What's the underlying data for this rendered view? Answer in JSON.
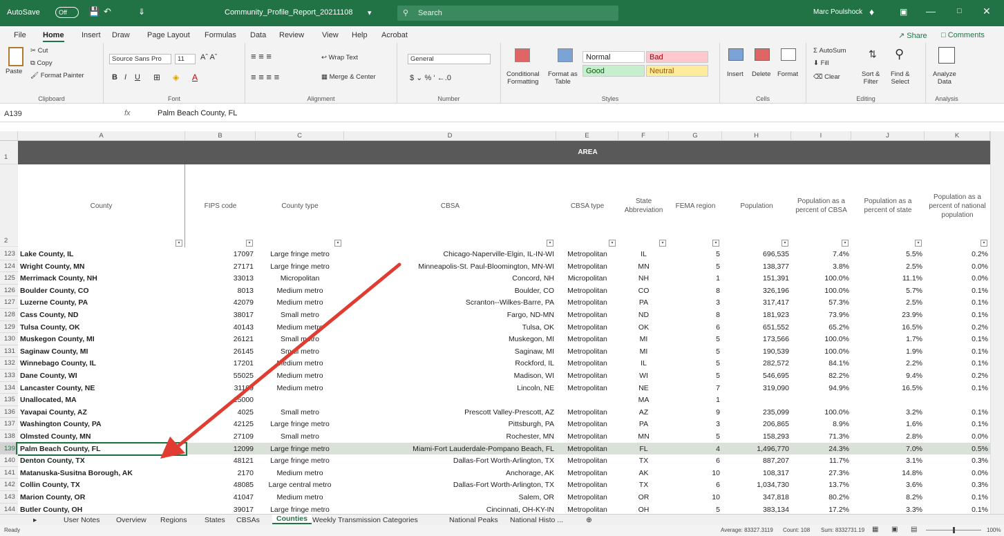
{
  "titlebar": {
    "autosave": "AutoSave",
    "autosave_state": "Off",
    "filename": "Community_Profile_Report_20211108",
    "search": "Search",
    "user": "Marc Poulshock"
  },
  "ribbon_tabs": [
    "File",
    "Home",
    "Insert",
    "Draw",
    "Page Layout",
    "Formulas",
    "Data",
    "Review",
    "View",
    "Help",
    "Acrobat"
  ],
  "share_label": "Share",
  "comments_label": "Comments",
  "clipboard": {
    "paste": "Paste",
    "cut": "Cut",
    "copy": "Copy",
    "format_painter": "Format Painter",
    "label": "Clipboard"
  },
  "font": {
    "name": "Source Sans Pro",
    "size": "11",
    "label": "Font"
  },
  "alignment": {
    "wrap": "Wrap Text",
    "merge": "Merge & Center",
    "label": "Alignment"
  },
  "number": {
    "format": "General",
    "label": "Number"
  },
  "styles": {
    "conditional": "Conditional",
    "formatting": "Formatting",
    "format_as": "Format as",
    "table": "Table",
    "normal": "Normal",
    "bad": "Bad",
    "good": "Good",
    "neutral": "Neutral",
    "label": "Styles"
  },
  "cells": {
    "insert": "Insert",
    "delete": "Delete",
    "format": "Format",
    "label": "Cells"
  },
  "editing": {
    "autosum": "AutoSum",
    "fill": "Fill",
    "clear": "Clear",
    "sort": "Sort &",
    "filter": "Filter",
    "find": "Find &",
    "select": "Select",
    "label": "Editing"
  },
  "analysis": {
    "analyze": "Analyze",
    "data": "Data",
    "label": "Analysis"
  },
  "formula_bar": {
    "name_box": "A139",
    "fx": "fx",
    "value": "Palm Beach County, FL"
  },
  "columns": [
    "A",
    "B",
    "C",
    "D",
    "E",
    "F",
    "G",
    "H",
    "I",
    "J",
    "K"
  ],
  "area_header": "AREA",
  "headers": [
    "County",
    "FIPS code",
    "County type",
    "CBSA",
    "CBSA type",
    "State Abbreviation",
    "FEMA region",
    "Population",
    "Population as a percent of CBSA",
    "Population as a percent of state",
    "Population as a percent of national population"
  ],
  "header_rownums": [
    "1",
    "2"
  ],
  "rows": [
    [
      "123",
      "Lake County, IL",
      "17097",
      "Large fringe metro",
      "Chicago-Naperville-Elgin, IL-IN-WI",
      "Metropolitan",
      "IL",
      "5",
      "696,535",
      "7.4%",
      "5.5%",
      "0.2%"
    ],
    [
      "124",
      "Wright County, MN",
      "27171",
      "Large fringe metro",
      "Minneapolis-St. Paul-Bloomington, MN-WI",
      "Metropolitan",
      "MN",
      "5",
      "138,377",
      "3.8%",
      "2.5%",
      "0.0%"
    ],
    [
      "125",
      "Merrimack County, NH",
      "33013",
      "Micropolitan",
      "Concord, NH",
      "Micropolitan",
      "NH",
      "1",
      "151,391",
      "100.0%",
      "11.1%",
      "0.0%"
    ],
    [
      "126",
      "Boulder County, CO",
      "8013",
      "Medium metro",
      "Boulder, CO",
      "Metropolitan",
      "CO",
      "8",
      "326,196",
      "100.0%",
      "5.7%",
      "0.1%"
    ],
    [
      "127",
      "Luzerne County, PA",
      "42079",
      "Medium metro",
      "Scranton--Wilkes-Barre, PA",
      "Metropolitan",
      "PA",
      "3",
      "317,417",
      "57.3%",
      "2.5%",
      "0.1%"
    ],
    [
      "128",
      "Cass County, ND",
      "38017",
      "Small metro",
      "Fargo, ND-MN",
      "Metropolitan",
      "ND",
      "8",
      "181,923",
      "73.9%",
      "23.9%",
      "0.1%"
    ],
    [
      "129",
      "Tulsa County, OK",
      "40143",
      "Medium metro",
      "Tulsa, OK",
      "Metropolitan",
      "OK",
      "6",
      "651,552",
      "65.2%",
      "16.5%",
      "0.2%"
    ],
    [
      "130",
      "Muskegon County, MI",
      "26121",
      "Small metro",
      "Muskegon, MI",
      "Metropolitan",
      "MI",
      "5",
      "173,566",
      "100.0%",
      "1.7%",
      "0.1%"
    ],
    [
      "131",
      "Saginaw County, MI",
      "26145",
      "Small metro",
      "Saginaw, MI",
      "Metropolitan",
      "MI",
      "5",
      "190,539",
      "100.0%",
      "1.9%",
      "0.1%"
    ],
    [
      "132",
      "Winnebago County, IL",
      "17201",
      "Medium metro",
      "Rockford, IL",
      "Metropolitan",
      "IL",
      "5",
      "282,572",
      "84.1%",
      "2.2%",
      "0.1%"
    ],
    [
      "133",
      "Dane County, WI",
      "55025",
      "Medium metro",
      "Madison, WI",
      "Metropolitan",
      "WI",
      "5",
      "546,695",
      "82.2%",
      "9.4%",
      "0.2%"
    ],
    [
      "134",
      "Lancaster County, NE",
      "31109",
      "Medium metro",
      "Lincoln, NE",
      "Metropolitan",
      "NE",
      "7",
      "319,090",
      "94.9%",
      "16.5%",
      "0.1%"
    ],
    [
      "135",
      "Unallocated, MA",
      "25000",
      "",
      "",
      "",
      "MA",
      "1",
      "",
      "",
      "",
      ""
    ],
    [
      "136",
      "Yavapai County, AZ",
      "4025",
      "Small metro",
      "Prescott Valley-Prescott, AZ",
      "Metropolitan",
      "AZ",
      "9",
      "235,099",
      "100.0%",
      "3.2%",
      "0.1%"
    ],
    [
      "137",
      "Washington County, PA",
      "42125",
      "Large fringe metro",
      "Pittsburgh, PA",
      "Metropolitan",
      "PA",
      "3",
      "206,865",
      "8.9%",
      "1.6%",
      "0.1%"
    ],
    [
      "138",
      "Olmsted County, MN",
      "27109",
      "Small metro",
      "Rochester, MN",
      "Metropolitan",
      "MN",
      "5",
      "158,293",
      "71.3%",
      "2.8%",
      "0.0%"
    ],
    [
      "139",
      "Palm Beach County, FL",
      "12099",
      "Large fringe metro",
      "Miami-Fort Lauderdale-Pompano Beach, FL",
      "Metropolitan",
      "FL",
      "4",
      "1,496,770",
      "24.3%",
      "7.0%",
      "0.5%"
    ],
    [
      "140",
      "Denton County, TX",
      "48121",
      "Large fringe metro",
      "Dallas-Fort Worth-Arlington, TX",
      "Metropolitan",
      "TX",
      "6",
      "887,207",
      "11.7%",
      "3.1%",
      "0.3%"
    ],
    [
      "141",
      "Matanuska-Susitna Borough, AK",
      "2170",
      "Medium metro",
      "Anchorage, AK",
      "Metropolitan",
      "AK",
      "10",
      "108,317",
      "27.3%",
      "14.8%",
      "0.0%"
    ],
    [
      "142",
      "Collin County, TX",
      "48085",
      "Large central metro",
      "Dallas-Fort Worth-Arlington, TX",
      "Metropolitan",
      "TX",
      "6",
      "1,034,730",
      "13.7%",
      "3.6%",
      "0.3%"
    ],
    [
      "143",
      "Marion County, OR",
      "41047",
      "Medium metro",
      "Salem, OR",
      "Metropolitan",
      "OR",
      "10",
      "347,818",
      "80.2%",
      "8.2%",
      "0.1%"
    ],
    [
      "144",
      "Butler County, OH",
      "39017",
      "Large fringe metro",
      "Cincinnati, OH-KY-IN",
      "Metropolitan",
      "OH",
      "5",
      "383,134",
      "17.2%",
      "3.3%",
      "0.1%"
    ]
  ],
  "sheet_tabs": [
    "User Notes",
    "Overview",
    "Regions",
    "States",
    "CBSAs",
    "Counties",
    "Weekly Transmission Categories",
    "National Peaks",
    "National Histo ..."
  ],
  "active_sheet": "Counties",
  "status": {
    "ready": "Ready",
    "average": "Average: 83327.3119",
    "count": "Count: 108",
    "sum": "Sum: 8332731.19",
    "zoom": "100%"
  },
  "colors": {
    "excel_green": "#217346",
    "header_dark": "#595959",
    "highlight": "#d9e1d9",
    "arrow": "#e03c31"
  }
}
